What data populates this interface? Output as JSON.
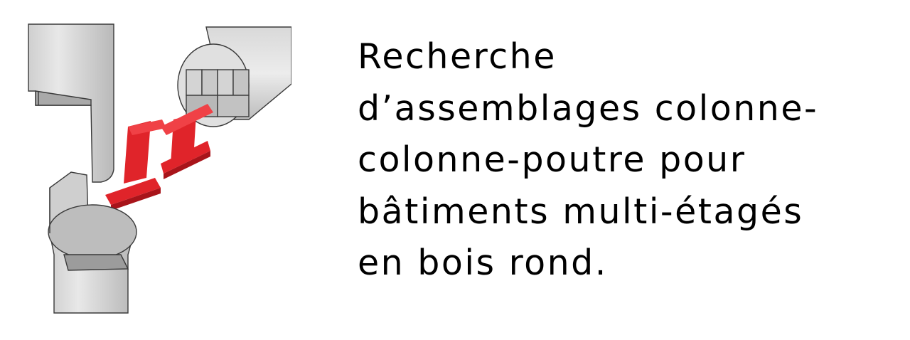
{
  "title_lines": [
    "Recherche",
    "d’assemblages colonne-",
    "colonne-poutre pour",
    "bâtiments multi-étagés",
    "en bois rond."
  ],
  "illustration": {
    "subject": "column-column-beam round timber joint with red steel I-section connectors",
    "colors": {
      "wood_light": "#e4e4e4",
      "wood_mid": "#cfcfcf",
      "wood_dark": "#a9a9a9",
      "edge": "#3a3a3a",
      "steel": "#e0242a",
      "steel_dark": "#a8141a"
    }
  }
}
